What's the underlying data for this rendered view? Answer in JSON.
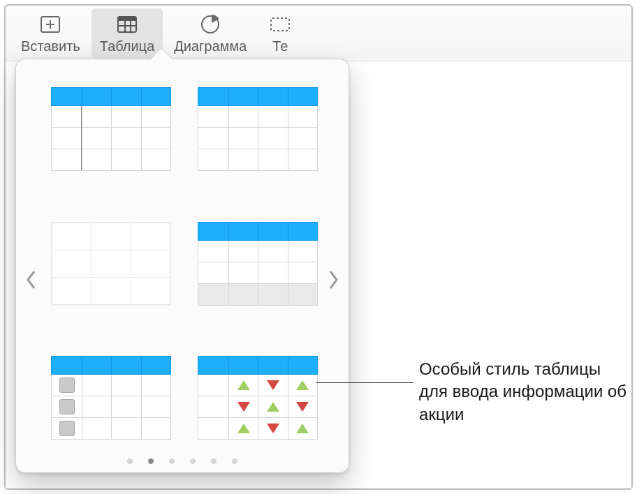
{
  "toolbar": {
    "insert": "Вставить",
    "table": "Таблица",
    "chart": "Диаграмма",
    "text_truncated": "Те"
  },
  "popover": {
    "styles": [
      "table-blue-header-basic",
      "table-blue-header-no-verticals",
      "table-plain-no-header",
      "table-blue-header-with-footer",
      "table-blue-header-checkboxes",
      "table-blue-header-stock-triangles"
    ],
    "page_count": 6,
    "active_page_index": 1
  },
  "callout": {
    "text": "Особый стиль таблицы для ввода информации об акции"
  }
}
